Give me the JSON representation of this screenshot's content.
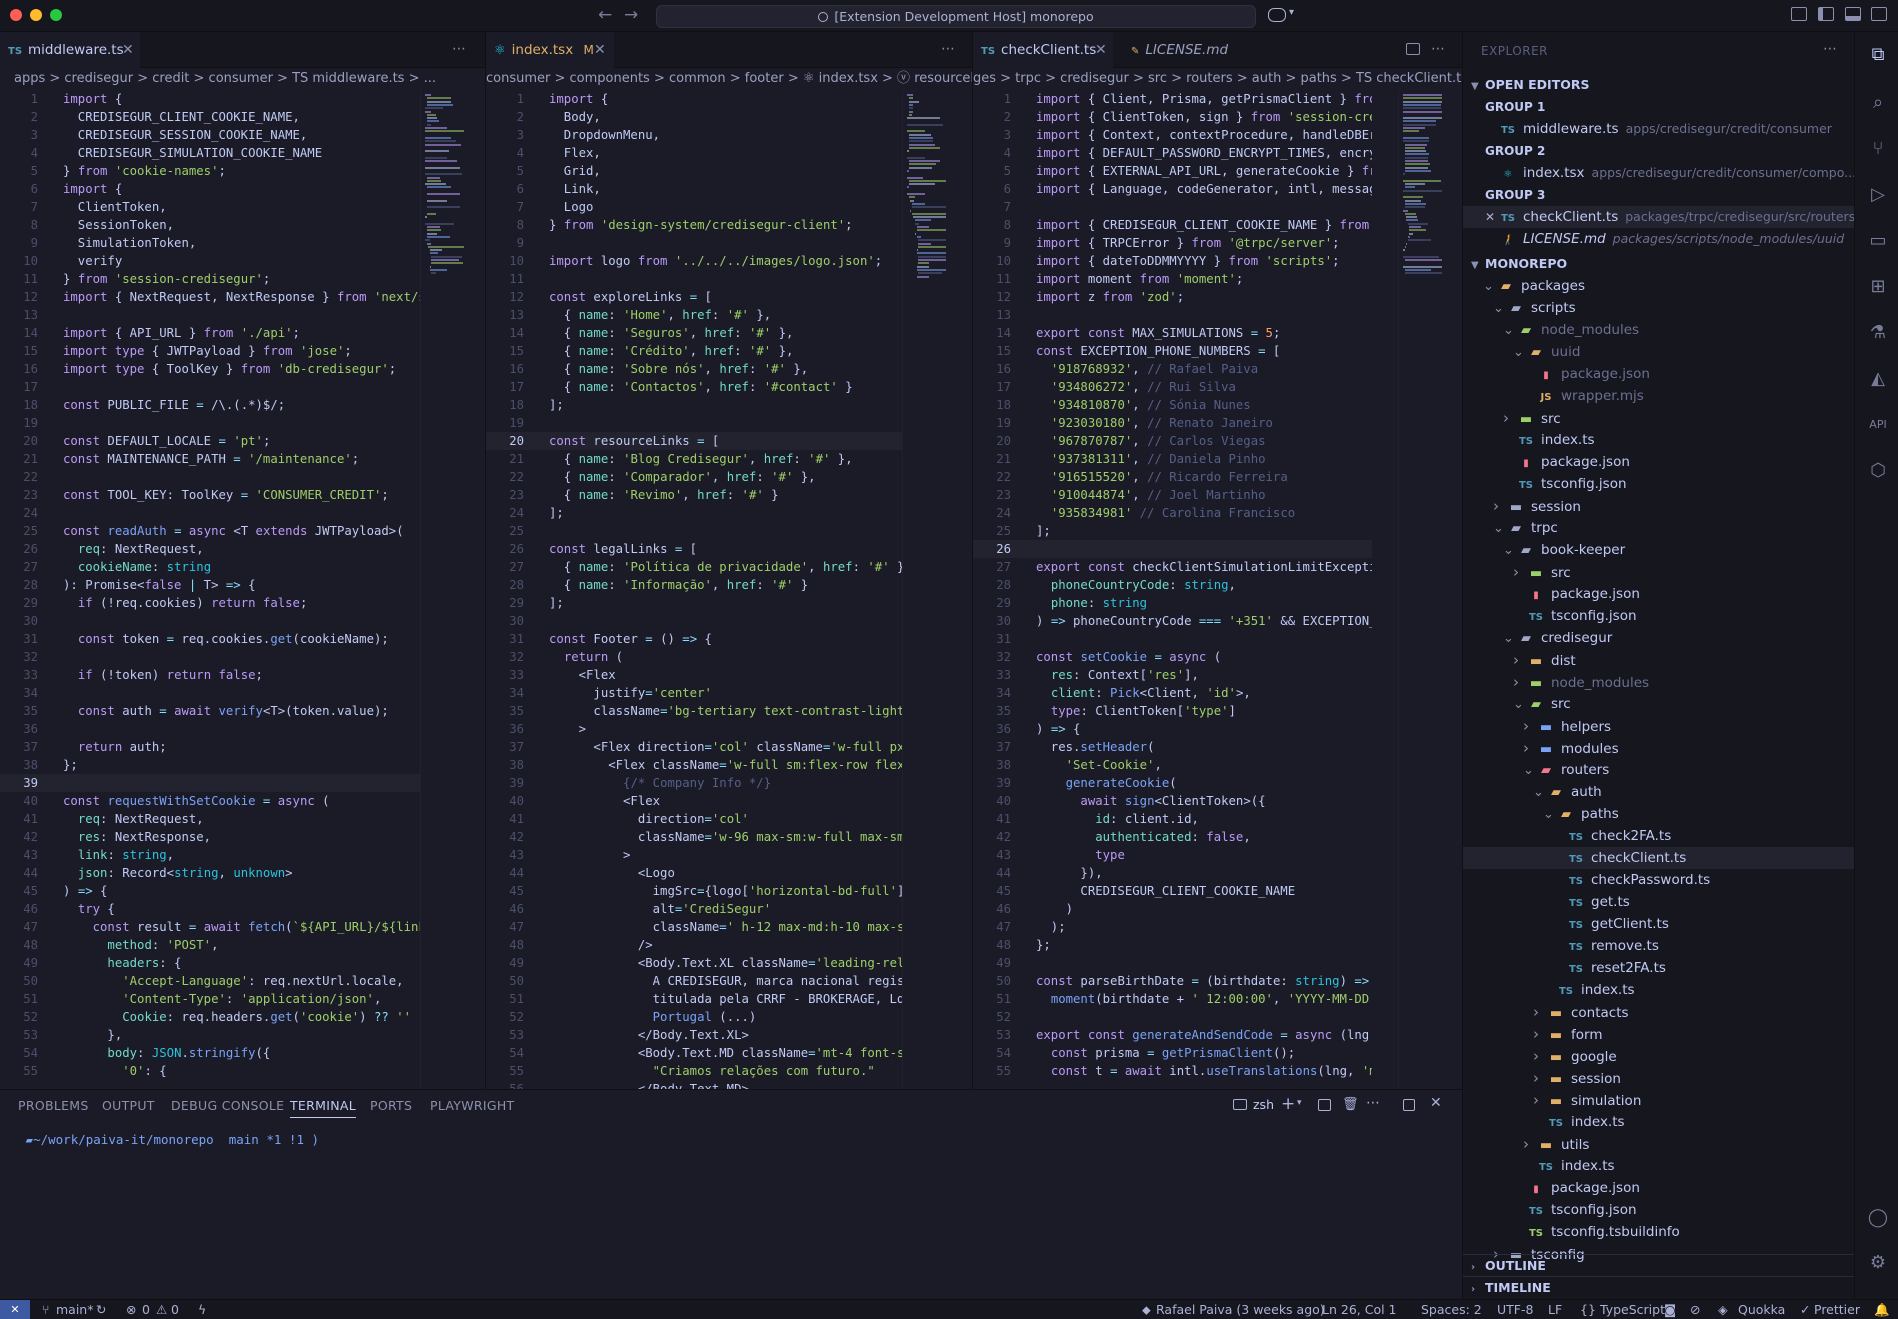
{
  "window": {
    "title": "[Extension Development Host] monorepo",
    "nav_back": "←",
    "nav_forward": "→"
  },
  "groups": [
    {
      "tabs": [
        {
          "label": "middleware.ts",
          "icon": "TS",
          "icon_color": "#519aba",
          "active": true,
          "modified": false,
          "close": "✕"
        }
      ],
      "breadcrumb": "apps > credisegur > credit > consumer > TS middleware.ts > ...",
      "current_line": 39,
      "lines": [
        "import {",
        "  CREDISEGUR_CLIENT_COOKIE_NAME,",
        "  CREDISEGUR_SESSION_COOKIE_NAME,",
        "  CREDISEGUR_SIMULATION_COOKIE_NAME",
        "} from 'cookie-names';",
        "import {",
        "  ClientToken,",
        "  SessionToken,",
        "  SimulationToken,",
        "  verify",
        "} from 'session-credisegur';",
        "import { NextRequest, NextResponse } from 'next/s",
        "",
        "import { API_URL } from './api';",
        "import type { JWTPayload } from 'jose';",
        "import type { ToolKey } from 'db-credisegur';",
        "",
        "const PUBLIC_FILE = /\\.(.*)$/;",
        "",
        "const DEFAULT_LOCALE = 'pt';",
        "const MAINTENANCE_PATH = '/maintenance';",
        "",
        "const TOOL_KEY: ToolKey = 'CONSUMER_CREDIT';",
        "",
        "const readAuth = async <T extends JWTPayload>(",
        "  req: NextRequest,",
        "  cookieName: string",
        "): Promise<false | T> => {",
        "  if (!req.cookies) return false;",
        "",
        "  const token = req.cookies.get(cookieName);",
        "",
        "  if (!token) return false;",
        "",
        "  const auth = await verify<T>(token.value);",
        "",
        "  return auth;",
        "};",
        "",
        "const requestWithSetCookie = async (",
        "  req: NextRequest,",
        "  res: NextResponse,",
        "  link: string,",
        "  json: Record<string, unknown>",
        ") => {",
        "  try {",
        "    const result = await fetch(`${API_URL}/${link",
        "      method: 'POST',",
        "      headers: {",
        "        'Accept-Language': req.nextUrl.locale,",
        "        'Content-Type': 'application/json',",
        "        Cookie: req.headers.get('cookie') ?? ''",
        "      },",
        "      body: JSON.stringify({",
        "        '0': {"
      ]
    },
    {
      "tabs": [
        {
          "label": "index.tsx",
          "icon": "⚛",
          "icon_color": "#2ac3de",
          "active": true,
          "modified": true,
          "modified_mark": "M",
          "close": "✕"
        }
      ],
      "breadcrumb": "consumer > components > common > footer > ⚛ index.tsx > ⓥ resourceLinks",
      "current_line": 20,
      "lines": [
        "import {",
        "  Body,",
        "  DropdownMenu,",
        "  Flex,",
        "  Grid,",
        "  Link,",
        "  Logo",
        "} from 'design-system/credisegur-client';",
        "",
        "import logo from '../../../images/logo.json';",
        "",
        "const exploreLinks = [",
        "  { name: 'Home', href: '#' },",
        "  { name: 'Seguros', href: '#' },",
        "  { name: 'Crédito', href: '#' },",
        "  { name: 'Sobre nós', href: '#' },",
        "  { name: 'Contactos', href: '#contact' }",
        "];",
        "",
        "const resourceLinks = [",
        "  { name: 'Blog Credisegur', href: '#' },",
        "  { name: 'Comparador', href: '#' },",
        "  { name: 'Revimo', href: '#' }",
        "];",
        "",
        "const legalLinks = [",
        "  { name: 'Política de privacidade', href: '#' },",
        "  { name: 'Informação', href: '#' }",
        "];",
        "",
        "const Footer = () => {",
        "  return (",
        "    <Flex",
        "      justify='center'",
        "      className='bg-tertiary text-contrast-light-",
        "    >",
        "      <Flex direction='col' className='w-full px-",
        "        <Flex className='w-full sm:flex-row flex-",
        "          {/* Company Info */}",
        "          <Flex",
        "            direction='col'",
        "            className='w-96 max-sm:w-full max-sm:",
        "          >",
        "            <Logo",
        "              imgSrc={logo['horizontal-bd-full']}",
        "              alt='CrediSegur'",
        "              className=' h-12 max-md:h-10 max-sm",
        "            />",
        "            <Body.Text.XL className='leading-rela",
        "              A CREDISEGUR, marca nacional regist",
        "              titulada pela CRRF - BROKERAGE, Lda",
        "              Portugal (...)",
        "            </Body.Text.XL>",
        "            <Body.Text.MD className='mt-4 font-se",
        "              \"Criamos relações com futuro.\"",
        "            </Body.Text.MD>"
      ]
    },
    {
      "tabs": [
        {
          "label": "checkClient.ts",
          "icon": "TS",
          "icon_color": "#519aba",
          "active": true,
          "modified": false,
          "close": "✕"
        },
        {
          "label": "LICENSE.md",
          "icon": "🚶",
          "icon_color": "#e0af68",
          "active": false,
          "modified": false,
          "close": ""
        }
      ],
      "breadcrumb": "ges > trpc > credisegur > src > routers > auth > paths > TS checkClient.ts",
      "current_line": 26,
      "lines": [
        "import { Client, Prisma, getPrismaClient } from '",
        "import { ClientToken, sign } from 'session-credis",
        "import { Context, contextProcedure, handleDBError",
        "import { DEFAULT_PASSWORD_ENCRYPT_TIMES, encrypt",
        "import { EXTERNAL_API_URL, generateCookie } from",
        "import { Language, codeGenerator, intl, messagebi",
        "",
        "import { CREDISEGUR_CLIENT_COOKIE_NAME } from 'co",
        "import { TRPCError } from '@trpc/server';",
        "import { dateToDDMMYYYY } from 'scripts';",
        "import moment from 'moment';",
        "import z from 'zod';",
        "",
        "export const MAX_SIMULATIONS = 5;",
        "const EXCEPTION_PHONE_NUMBERS = [",
        "  '918768932', // Rafael Paiva",
        "  '934806272', // Rui Silva",
        "  '934810870', // Sónia Nunes",
        "  '923030180', // Renato Janeiro",
        "  '967870787', // Carlos Viegas",
        "  '937381311', // Daniela Pinho",
        "  '916515520', // Ricardo Ferreira",
        "  '910044874', // Joel Martinho",
        "  '935834981' // Carolina Francisco",
        "];",
        "",
        "export const checkClientSimulationLimitException",
        "  phoneCountryCode: string,",
        "  phone: string",
        ") => phoneCountryCode === '+351' && EXCEPTION_PHO",
        "",
        "const setCookie = async (",
        "  res: Context['res'],",
        "  client: Pick<Client, 'id'>,",
        "  type: ClientToken['type']",
        ") => {",
        "  res.setHeader(",
        "    'Set-Cookie',",
        "    generateCookie(",
        "      await sign<ClientToken>({",
        "        id: client.id,",
        "        authenticated: false,",
        "        type",
        "      }),",
        "      CREDISEGUR_CLIENT_COOKIE_NAME",
        "    )",
        "  );",
        "};",
        "",
        "const parseBirthDate = (birthdate: string) =>",
        "  moment(birthdate + ' 12:00:00', 'YYYY-MM-DD HH:",
        "",
        "export const generateAndSendCode = async (lng: La",
        "  const prisma = getPrismaClient();",
        "  const t = await intl.useTranslations(lng, 'mess"
      ]
    }
  ],
  "panel": {
    "tabs": [
      "PROBLEMS",
      "OUTPUT",
      "DEBUG CONSOLE",
      "TERMINAL",
      "PORTS",
      "PLAYWRIGHT"
    ],
    "active_tab": "TERMINAL",
    "shell": "zsh",
    "prompt": "~/work/paiva-it/monorepo  main *1 !1 )"
  },
  "explorer": {
    "header": "EXPLORER",
    "open_editors_label": "OPEN EDITORS",
    "open_editors": [
      {
        "type": "group",
        "label": "GROUP 1"
      },
      {
        "type": "file",
        "label": "middleware.ts",
        "icon": "TS",
        "icon_color": "#519aba",
        "desc": "apps/credisegur/credit/consumer"
      },
      {
        "type": "group",
        "label": "GROUP 2"
      },
      {
        "type": "file",
        "label": "index.tsx",
        "icon": "⚛",
        "icon_color": "#2ac3de",
        "desc": "apps/credisegur/credit/consumer/compo...",
        "badge": "M"
      },
      {
        "type": "group",
        "label": "GROUP 3"
      },
      {
        "type": "file",
        "label": "checkClient.ts",
        "icon": "TS",
        "icon_color": "#519aba",
        "desc": "packages/trpc/credisegur/src/routers/au...",
        "selected": true
      },
      {
        "type": "file",
        "label": "LICENSE.md",
        "icon": "🚶",
        "icon_color": "#e0af68",
        "desc": "packages/scripts/node_modules/uuid",
        "italic": true
      }
    ],
    "workspace_label": "MONOREPO",
    "tree": [
      {
        "depth": 1,
        "label": "packages",
        "kind": "folder-open",
        "icon_color": "#e0af68"
      },
      {
        "depth": 2,
        "label": "scripts",
        "kind": "folder-open",
        "icon_color": "#a0a8c8"
      },
      {
        "depth": 3,
        "label": "node_modules",
        "kind": "folder-open",
        "icon_color": "#9ece6a",
        "dim": true
      },
      {
        "depth": 4,
        "label": "uuid",
        "kind": "folder-open",
        "icon_color": "#e0af68",
        "dim": true
      },
      {
        "depth": 5,
        "label": "package.json",
        "kind": "file",
        "icon": "▮",
        "icon_color": "#f7768e",
        "dim": true
      },
      {
        "depth": 5,
        "label": "wrapper.mjs",
        "kind": "file",
        "icon": "JS",
        "icon_color": "#e0af68",
        "dim": true
      },
      {
        "depth": 3,
        "label": "src",
        "kind": "folder",
        "icon_color": "#9ece6a"
      },
      {
        "depth": 3,
        "label": "index.ts",
        "kind": "file",
        "icon": "TS",
        "icon_color": "#519aba"
      },
      {
        "depth": 3,
        "label": "package.json",
        "kind": "file",
        "icon": "▮",
        "icon_color": "#f7768e"
      },
      {
        "depth": 3,
        "label": "tsconfig.json",
        "kind": "file",
        "icon": "TS",
        "icon_color": "#519aba"
      },
      {
        "depth": 2,
        "label": "session",
        "kind": "folder",
        "icon_color": "#a0a8c8"
      },
      {
        "depth": 2,
        "label": "trpc",
        "kind": "folder-open",
        "icon_color": "#a0a8c8"
      },
      {
        "depth": 3,
        "label": "book-keeper",
        "kind": "folder-open",
        "icon_color": "#a0a8c8"
      },
      {
        "depth": 4,
        "label": "src",
        "kind": "folder",
        "icon_color": "#9ece6a"
      },
      {
        "depth": 4,
        "label": "package.json",
        "kind": "file",
        "icon": "▮",
        "icon_color": "#f7768e"
      },
      {
        "depth": 4,
        "label": "tsconfig.json",
        "kind": "file",
        "icon": "TS",
        "icon_color": "#519aba"
      },
      {
        "depth": 3,
        "label": "credisegur",
        "kind": "folder-open",
        "icon_color": "#a0a8c8"
      },
      {
        "depth": 4,
        "label": "dist",
        "kind": "folder",
        "icon_color": "#e0af68"
      },
      {
        "depth": 4,
        "label": "node_modules",
        "kind": "folder",
        "icon_color": "#9ece6a",
        "dim": true
      },
      {
        "depth": 4,
        "label": "src",
        "kind": "folder-open",
        "icon_color": "#9ece6a"
      },
      {
        "depth": 5,
        "label": "helpers",
        "kind": "folder",
        "icon_color": "#7aa2f7"
      },
      {
        "depth": 5,
        "label": "modules",
        "kind": "folder",
        "icon_color": "#7aa2f7"
      },
      {
        "depth": 5,
        "label": "routers",
        "kind": "folder-open",
        "icon_color": "#f7768e"
      },
      {
        "depth": 6,
        "label": "auth",
        "kind": "folder-open",
        "icon_color": "#e0af68"
      },
      {
        "depth": 7,
        "label": "paths",
        "kind": "folder-open",
        "icon_color": "#e0af68"
      },
      {
        "depth": 8,
        "label": "check2FA.ts",
        "kind": "file",
        "icon": "TS",
        "icon_color": "#519aba"
      },
      {
        "depth": 8,
        "label": "checkClient.ts",
        "kind": "file",
        "icon": "TS",
        "icon_color": "#519aba",
        "selected": true
      },
      {
        "depth": 8,
        "label": "checkPassword.ts",
        "kind": "file",
        "icon": "TS",
        "icon_color": "#519aba"
      },
      {
        "depth": 8,
        "label": "get.ts",
        "kind": "file",
        "icon": "TS",
        "icon_color": "#519aba"
      },
      {
        "depth": 8,
        "label": "getClient.ts",
        "kind": "file",
        "icon": "TS",
        "icon_color": "#519aba"
      },
      {
        "depth": 8,
        "label": "remove.ts",
        "kind": "file",
        "icon": "TS",
        "icon_color": "#519aba"
      },
      {
        "depth": 8,
        "label": "reset2FA.ts",
        "kind": "file",
        "icon": "TS",
        "icon_color": "#519aba"
      },
      {
        "depth": 7,
        "label": "index.ts",
        "kind": "file",
        "icon": "TS",
        "icon_color": "#519aba"
      },
      {
        "depth": 6,
        "label": "contacts",
        "kind": "folder",
        "icon_color": "#e0af68"
      },
      {
        "depth": 6,
        "label": "form",
        "kind": "folder",
        "icon_color": "#e0af68"
      },
      {
        "depth": 6,
        "label": "google",
        "kind": "folder",
        "icon_color": "#e0af68"
      },
      {
        "depth": 6,
        "label": "session",
        "kind": "folder",
        "icon_color": "#e0af68"
      },
      {
        "depth": 6,
        "label": "simulation",
        "kind": "folder",
        "icon_color": "#e0af68"
      },
      {
        "depth": 6,
        "label": "index.ts",
        "kind": "file",
        "icon": "TS",
        "icon_color": "#519aba"
      },
      {
        "depth": 5,
        "label": "utils",
        "kind": "folder",
        "icon_color": "#e0af68"
      },
      {
        "depth": 5,
        "label": "index.ts",
        "kind": "file",
        "icon": "TS",
        "icon_color": "#519aba"
      },
      {
        "depth": 4,
        "label": "package.json",
        "kind": "file",
        "icon": "▮",
        "icon_color": "#f7768e"
      },
      {
        "depth": 4,
        "label": "tsconfig.json",
        "kind": "file",
        "icon": "TS",
        "icon_color": "#519aba"
      },
      {
        "depth": 4,
        "label": "tsconfig.tsbuildinfo",
        "kind": "file",
        "icon": "TS",
        "icon_color": "#9ece6a"
      },
      {
        "depth": 2,
        "label": "tsconfig",
        "kind": "folder",
        "icon_color": "#a0a8c8"
      }
    ],
    "outline_label": "OUTLINE",
    "timeline_label": "TIMELINE"
  },
  "status": {
    "branch": "main*",
    "errors": "0",
    "warnings": "0",
    "blame": "Rafael Paiva (3 weeks ago)",
    "position": "Ln 26, Col 1",
    "spaces": "Spaces: 2",
    "encoding": "UTF-8",
    "eol": "LF",
    "language": "TypeScript",
    "quokka": "Quokka",
    "prettier": "Prettier"
  },
  "colors": {
    "keyword": "#bb9af7",
    "string": "#9ece6a",
    "function": "#7aa2f7",
    "type": "#2ac3de",
    "number": "#ff9e64",
    "comment": "#565f89",
    "accent": "#7aa2f7",
    "remote": "#3d59a1"
  }
}
